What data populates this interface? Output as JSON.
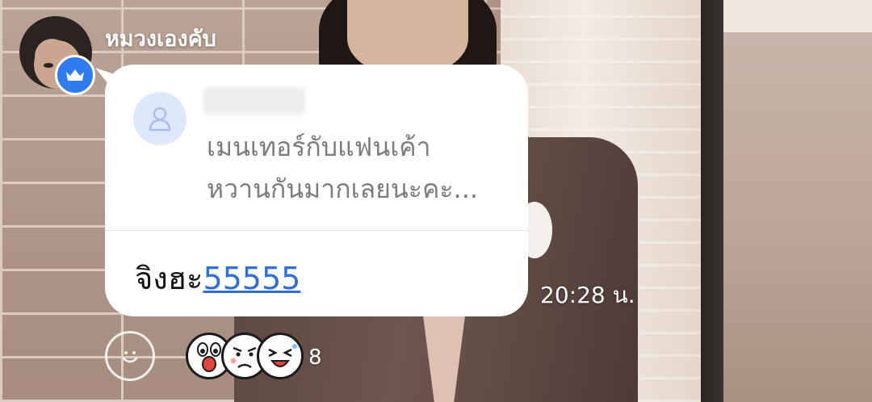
{
  "sender": {
    "name": "หมวงเองคับ",
    "badge_icon": "crown-icon",
    "badge_color": "#2e7bf2"
  },
  "reply_preview": {
    "avatar_icon": "user-placeholder-icon",
    "text_lines": [
      "เมนเทอร์กับแฟนเค้า",
      "หวานกันมากเลยนะคะ..."
    ]
  },
  "message": {
    "text": "จิงฮะ",
    "link_text": "55555",
    "link_color": "#2f6fdc",
    "timestamp": "20:28 น."
  },
  "reactions": {
    "add_reaction_icon": "smiley-icon",
    "stickers": [
      "shocked-sticker-icon",
      "worried-sticker-icon",
      "laughing-sticker-icon"
    ],
    "count": "8"
  }
}
